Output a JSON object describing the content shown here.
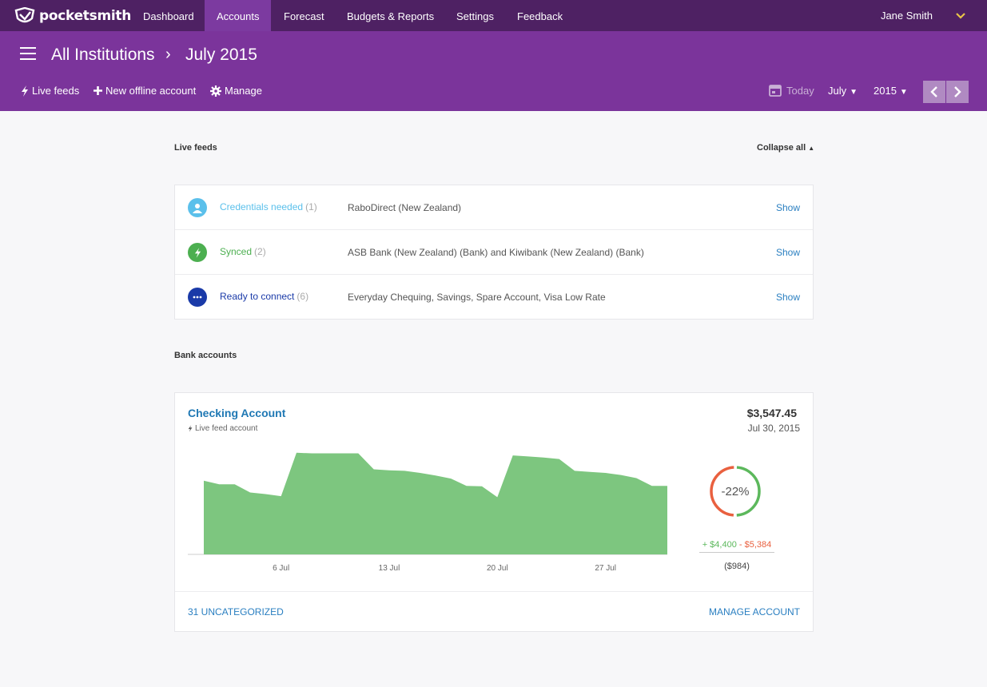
{
  "brand": {
    "name": "pocketsmith"
  },
  "nav": {
    "items": [
      {
        "label": "Dashboard"
      },
      {
        "label": "Accounts",
        "active": true
      },
      {
        "label": "Forecast"
      },
      {
        "label": "Budgets & Reports"
      },
      {
        "label": "Settings"
      },
      {
        "label": "Feedback"
      }
    ],
    "user": "Jane Smith"
  },
  "header": {
    "breadcrumb": [
      "All Institutions",
      "July 2015"
    ],
    "separator": "›",
    "tools": {
      "live_feeds": "Live feeds",
      "new_offline": "New offline account",
      "manage": "Manage"
    },
    "date": {
      "today": "Today",
      "month": "July",
      "year": "2015"
    }
  },
  "live_feeds": {
    "heading": "Live feeds",
    "collapse_label": "Collapse all",
    "rows": [
      {
        "status": "Credentials needed",
        "count": "(1)",
        "description": "RaboDirect (New Zealand)",
        "action": "Show",
        "color": "#5bc0eb",
        "icon": "user-icon"
      },
      {
        "status": "Synced",
        "count": "(2)",
        "description": "ASB Bank (New Zealand) (Bank) and Kiwibank (New Zealand) (Bank)",
        "action": "Show",
        "color": "#4caf50",
        "icon": "bolt-icon"
      },
      {
        "status": "Ready to connect",
        "count": "(6)",
        "description": "Everyday Chequing, Savings, Spare Account, Visa Low Rate",
        "action": "Show",
        "color": "#1a3aa8",
        "icon": "ellipsis-icon"
      }
    ]
  },
  "bank_accounts": {
    "heading": "Bank accounts",
    "account": {
      "name": "Checking Account",
      "subtitle": "Live feed account",
      "balance": "$3,547.45",
      "balance_date": "Jul 30, 2015",
      "change_percent": "-22%",
      "income": "+ $4,400",
      "separator": "-",
      "expense": "$5,384",
      "net": "($984)",
      "uncategorized": "31 UNCATEGORIZED",
      "manage": "MANAGE ACCOUNT"
    }
  },
  "chart_data": {
    "type": "area",
    "x": [
      "1 Jul",
      "2 Jul",
      "3 Jul",
      "4 Jul",
      "5 Jul",
      "6 Jul",
      "7 Jul",
      "8 Jul",
      "9 Jul",
      "10 Jul",
      "11 Jul",
      "12 Jul",
      "13 Jul",
      "14 Jul",
      "15 Jul",
      "16 Jul",
      "17 Jul",
      "18 Jul",
      "19 Jul",
      "20 Jul",
      "21 Jul",
      "22 Jul",
      "23 Jul",
      "24 Jul",
      "25 Jul",
      "26 Jul",
      "27 Jul",
      "28 Jul",
      "29 Jul",
      "30 Jul"
    ],
    "tick_labels": [
      "6 Jul",
      "13 Jul",
      "20 Jul",
      "27 Jul"
    ],
    "tick_values": [
      "6 Jul",
      "13 Jul",
      "20 Jul",
      "27 Jul"
    ],
    "series": [
      {
        "values": [
          4530,
          4460,
          4460,
          4300,
          4270,
          4230,
          5070,
          5060,
          5060,
          5060,
          5060,
          4750,
          4730,
          4720,
          4680,
          4630,
          4570,
          4430,
          4420,
          4210,
          5020,
          5000,
          4980,
          4950,
          4720,
          4700,
          4680,
          4640,
          4580,
          4430,
          4430
        ]
      }
    ],
    "color": "#7dc67f",
    "ylim": [
      3100,
      5300
    ],
    "grid": false,
    "donut": {
      "positive_fraction": 0.5,
      "colors": {
        "positive": "#5cb85c",
        "negative": "#e9603f"
      }
    }
  }
}
